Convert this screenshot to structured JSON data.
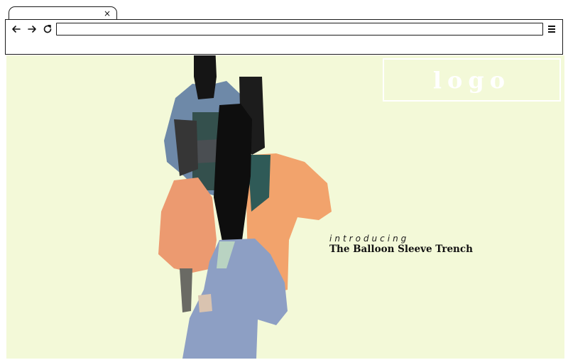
{
  "browser": {
    "tab_close_glyph": "×",
    "menu_icon": "hamburger-icon",
    "nav_icons": [
      "back-arrow-icon",
      "forward-arrow-icon",
      "reload-icon"
    ]
  },
  "page": {
    "background_color": "#f3f9d8",
    "logo": {
      "text": "logo"
    },
    "hero": {
      "eyebrow": "introducing",
      "title": "The Balloon Sleeve Trench"
    }
  }
}
